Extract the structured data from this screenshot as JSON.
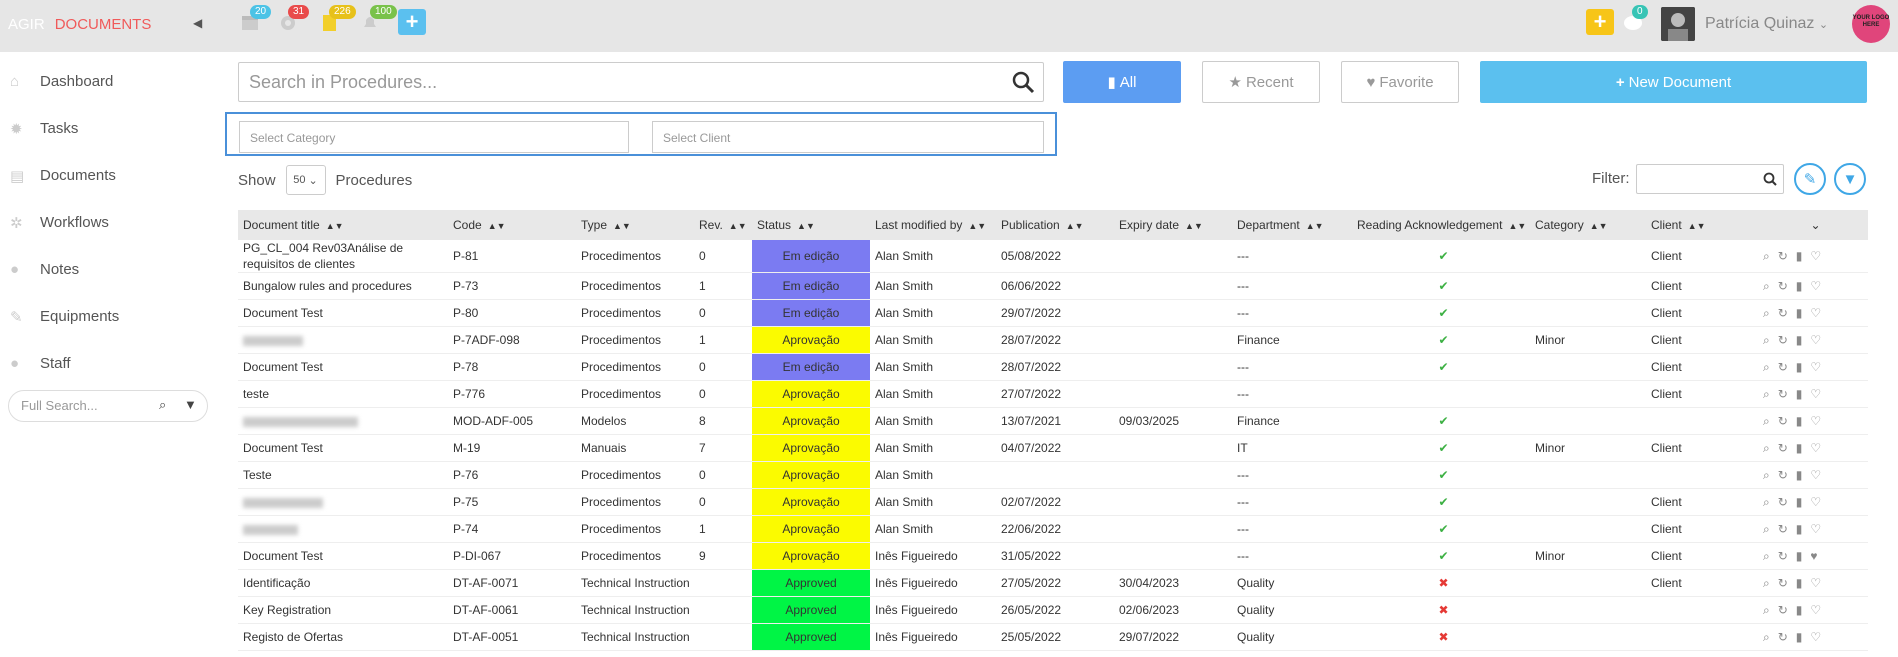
{
  "app": {
    "brand1": "AGIR",
    "brand2": "DOCUMENTS"
  },
  "topbar": {
    "badges": [
      {
        "icon": "calendar-icon",
        "count": "20",
        "color": "#4cc3e6"
      },
      {
        "icon": "gear-icon",
        "count": "31",
        "color": "#e94b4b"
      },
      {
        "icon": "document-icon",
        "count": "226",
        "color": "#e7c11a"
      },
      {
        "icon": "bell-icon",
        "count": "100",
        "color": "#79c24a"
      }
    ],
    "message_count": "0",
    "username": "Patrícia Quinaz",
    "logo_text": "YOUR LOGO HERE"
  },
  "sidebar": {
    "items": [
      {
        "label": "Dashboard",
        "icon": "home-icon"
      },
      {
        "label": "Tasks",
        "icon": "gear-icon"
      },
      {
        "label": "Documents",
        "icon": "file-icon"
      },
      {
        "label": "Workflows",
        "icon": "cogs-icon"
      },
      {
        "label": "Notes",
        "icon": "comments-icon"
      },
      {
        "label": "Equipments",
        "icon": "wrench-icon"
      },
      {
        "label": "Staff",
        "icon": "user-icon"
      }
    ],
    "search_placeholder": "Full Search..."
  },
  "main": {
    "search_placeholder": "Search in Procedures...",
    "filter_all": "All",
    "filter_recent": "Recent",
    "filter_favorite": "Favorite",
    "new_document": "New Document",
    "select_category": "Select Category",
    "select_client": "Select Client",
    "show_label": "Show",
    "show_value": "50",
    "entity_label": "Procedures",
    "filter_label": "Filter:"
  },
  "table": {
    "columns": [
      "Document title",
      "Code",
      "Type",
      "Rev.",
      "Status",
      "Last modified by",
      "Publication",
      "Expiry date",
      "Department",
      "Reading Acknowledgement",
      "Category",
      "Client"
    ],
    "rows": [
      {
        "title": "PG_CL_004 Rev03Análise de requisitos de clientes",
        "code": "P-81",
        "type": "Procedimentos",
        "rev": "0",
        "status": "Em edição",
        "modified": "Alan Smith",
        "pub": "05/08/2022",
        "exp": "",
        "dept": "---",
        "ack": "yes",
        "cat": "",
        "client": "Client",
        "fav": false
      },
      {
        "title": "Bungalow rules and procedures",
        "code": "P-73",
        "type": "Procedimentos",
        "rev": "1",
        "status": "Em edição",
        "modified": "Alan Smith",
        "pub": "06/06/2022",
        "exp": "",
        "dept": "---",
        "ack": "yes",
        "cat": "",
        "client": "Client",
        "fav": false
      },
      {
        "title": "Document Test",
        "code": "P-80",
        "type": "Procedimentos",
        "rev": "0",
        "status": "Em edição",
        "modified": "Alan Smith",
        "pub": "29/07/2022",
        "exp": "",
        "dept": "---",
        "ack": "yes",
        "cat": "",
        "client": "Client",
        "fav": false
      },
      {
        "title": "",
        "code": "P-7ADF-098",
        "type": "Procedimentos",
        "rev": "1",
        "status": "Aprovação",
        "modified": "Alan Smith",
        "pub": "28/07/2022",
        "exp": "",
        "dept": "Finance",
        "ack": "yes",
        "cat": "Minor",
        "client": "Client",
        "fav": false
      },
      {
        "title": "Document Test",
        "code": "P-78",
        "type": "Procedimentos",
        "rev": "0",
        "status": "Em edição",
        "modified": "Alan Smith",
        "pub": "28/07/2022",
        "exp": "",
        "dept": "---",
        "ack": "yes",
        "cat": "",
        "client": "Client",
        "fav": false
      },
      {
        "title": "teste",
        "code": "P-776",
        "type": "Procedimentos",
        "rev": "0",
        "status": "Aprovação",
        "modified": "Alan Smith",
        "pub": "27/07/2022",
        "exp": "",
        "dept": "---",
        "ack": "",
        "cat": "",
        "client": "Client",
        "fav": false
      },
      {
        "title": "",
        "code": "MOD-ADF-005",
        "type": "Modelos",
        "rev": "8",
        "status": "Aprovação",
        "modified": "Alan Smith",
        "pub": "13/07/2021",
        "exp": "09/03/2025",
        "dept": "Finance",
        "ack": "yes",
        "cat": "",
        "client": "",
        "fav": false
      },
      {
        "title": "Document Test",
        "code": "M-19",
        "type": "Manuais",
        "rev": "7",
        "status": "Aprovação",
        "modified": "Alan Smith",
        "pub": "04/07/2022",
        "exp": "",
        "dept": "IT",
        "ack": "yes",
        "cat": "Minor",
        "client": "Client",
        "fav": false
      },
      {
        "title": "Teste",
        "code": "P-76",
        "type": "Procedimentos",
        "rev": "0",
        "status": "Aprovação",
        "modified": "Alan Smith",
        "pub": "",
        "exp": "",
        "dept": "---",
        "ack": "yes",
        "cat": "",
        "client": "",
        "fav": false
      },
      {
        "title": "",
        "code": "P-75",
        "type": "Procedimentos",
        "rev": "0",
        "status": "Aprovação",
        "modified": "Alan Smith",
        "pub": "02/07/2022",
        "exp": "",
        "dept": "---",
        "ack": "yes",
        "cat": "",
        "client": "Client",
        "fav": false
      },
      {
        "title": "",
        "code": "P-74",
        "type": "Procedimentos",
        "rev": "1",
        "status": "Aprovação",
        "modified": "Alan Smith",
        "pub": "22/06/2022",
        "exp": "",
        "dept": "---",
        "ack": "yes",
        "cat": "",
        "client": "Client",
        "fav": false
      },
      {
        "title": "Document Test",
        "code": "P-DI-067",
        "type": "Procedimentos",
        "rev": "9",
        "status": "Aprovação",
        "modified": "Inês Figueiredo",
        "pub": "31/05/2022",
        "exp": "",
        "dept": "---",
        "ack": "yes",
        "cat": "Minor",
        "client": "Client",
        "fav": true
      },
      {
        "title": "Identificação",
        "code": "DT-AF-0071",
        "type": "Technical Instruction",
        "rev": "",
        "status": "Approved",
        "modified": "Inês Figueiredo",
        "pub": "27/05/2022",
        "exp": "30/04/2023",
        "dept": "Quality",
        "ack": "no",
        "cat": "",
        "client": "Client",
        "fav": false
      },
      {
        "title": "Key Registration",
        "code": "DT-AF-0061",
        "type": "Technical Instruction",
        "rev": "",
        "status": "Approved",
        "modified": "Inês Figueiredo",
        "pub": "26/05/2022",
        "exp": "02/06/2023",
        "dept": "Quality",
        "ack": "no",
        "cat": "",
        "client": "",
        "fav": false
      },
      {
        "title": "Registo de Ofertas",
        "code": "DT-AF-0051",
        "type": "Technical Instruction",
        "rev": "",
        "status": "Approved",
        "modified": "Inês Figueiredo",
        "pub": "25/05/2022",
        "exp": "29/07/2022",
        "dept": "Quality",
        "ack": "no",
        "cat": "",
        "client": "",
        "fav": false
      }
    ]
  }
}
